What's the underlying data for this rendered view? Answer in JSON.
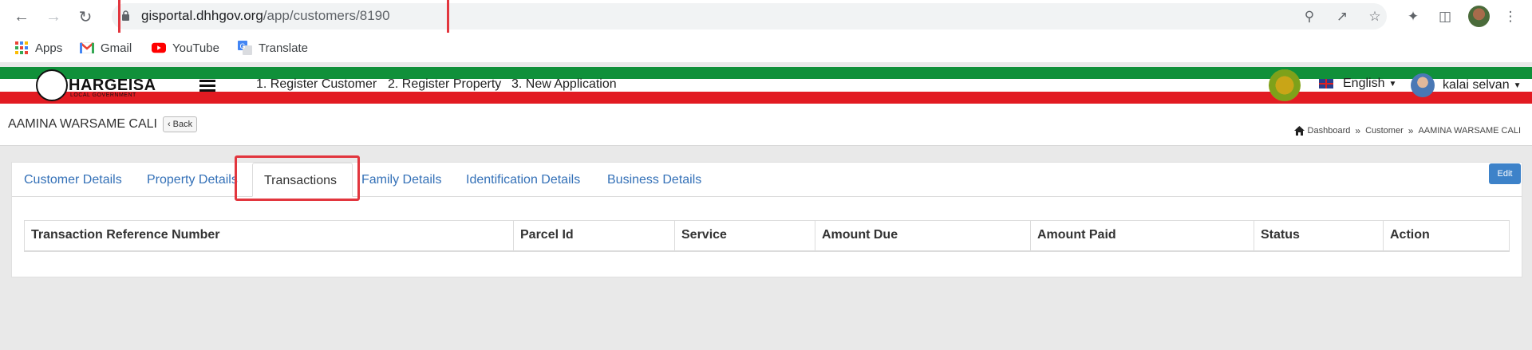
{
  "browser": {
    "url_host": "gisportal.dhhgov.org",
    "url_path": "/app/customers/8190",
    "bookmarks": [
      {
        "label": "Apps",
        "icon": "apps-grid-icon"
      },
      {
        "label": "Gmail",
        "icon": "gmail-icon"
      },
      {
        "label": "YouTube",
        "icon": "youtube-icon"
      },
      {
        "label": "Translate",
        "icon": "translate-icon"
      }
    ]
  },
  "header": {
    "logo_title": "HARGEISA",
    "logo_subtitle": "LOCAL GOVERNMENT",
    "menu": [
      "1. Register Customer",
      "2. Register Property",
      "3. New Application"
    ],
    "language": "English",
    "user_name": "kalai selvan"
  },
  "page": {
    "title": "AAMINA WARSAME CALI",
    "back_label": "Back",
    "breadcrumb": [
      "Dashboard",
      "Customer",
      "AAMINA WARSAME CALI"
    ]
  },
  "tabs": [
    {
      "label": "Customer Details",
      "active": false
    },
    {
      "label": "Property Details",
      "active": false
    },
    {
      "label": "Transactions",
      "active": true
    },
    {
      "label": "Family Details",
      "active": false
    },
    {
      "label": "Identification Details",
      "active": false
    },
    {
      "label": "Business Details",
      "active": false
    }
  ],
  "edit_label": "Edit",
  "table": {
    "columns": [
      "Transaction Reference Number",
      "Parcel Id",
      "Service",
      "Amount Due",
      "Amount Paid",
      "Status",
      "Action"
    ],
    "rows": []
  },
  "colors": {
    "stripe_green": "#10903a",
    "stripe_red": "#e21b22",
    "link_blue": "#3370b7",
    "edit_blue": "#3d82c9",
    "highlight_red": "#e2363e"
  }
}
